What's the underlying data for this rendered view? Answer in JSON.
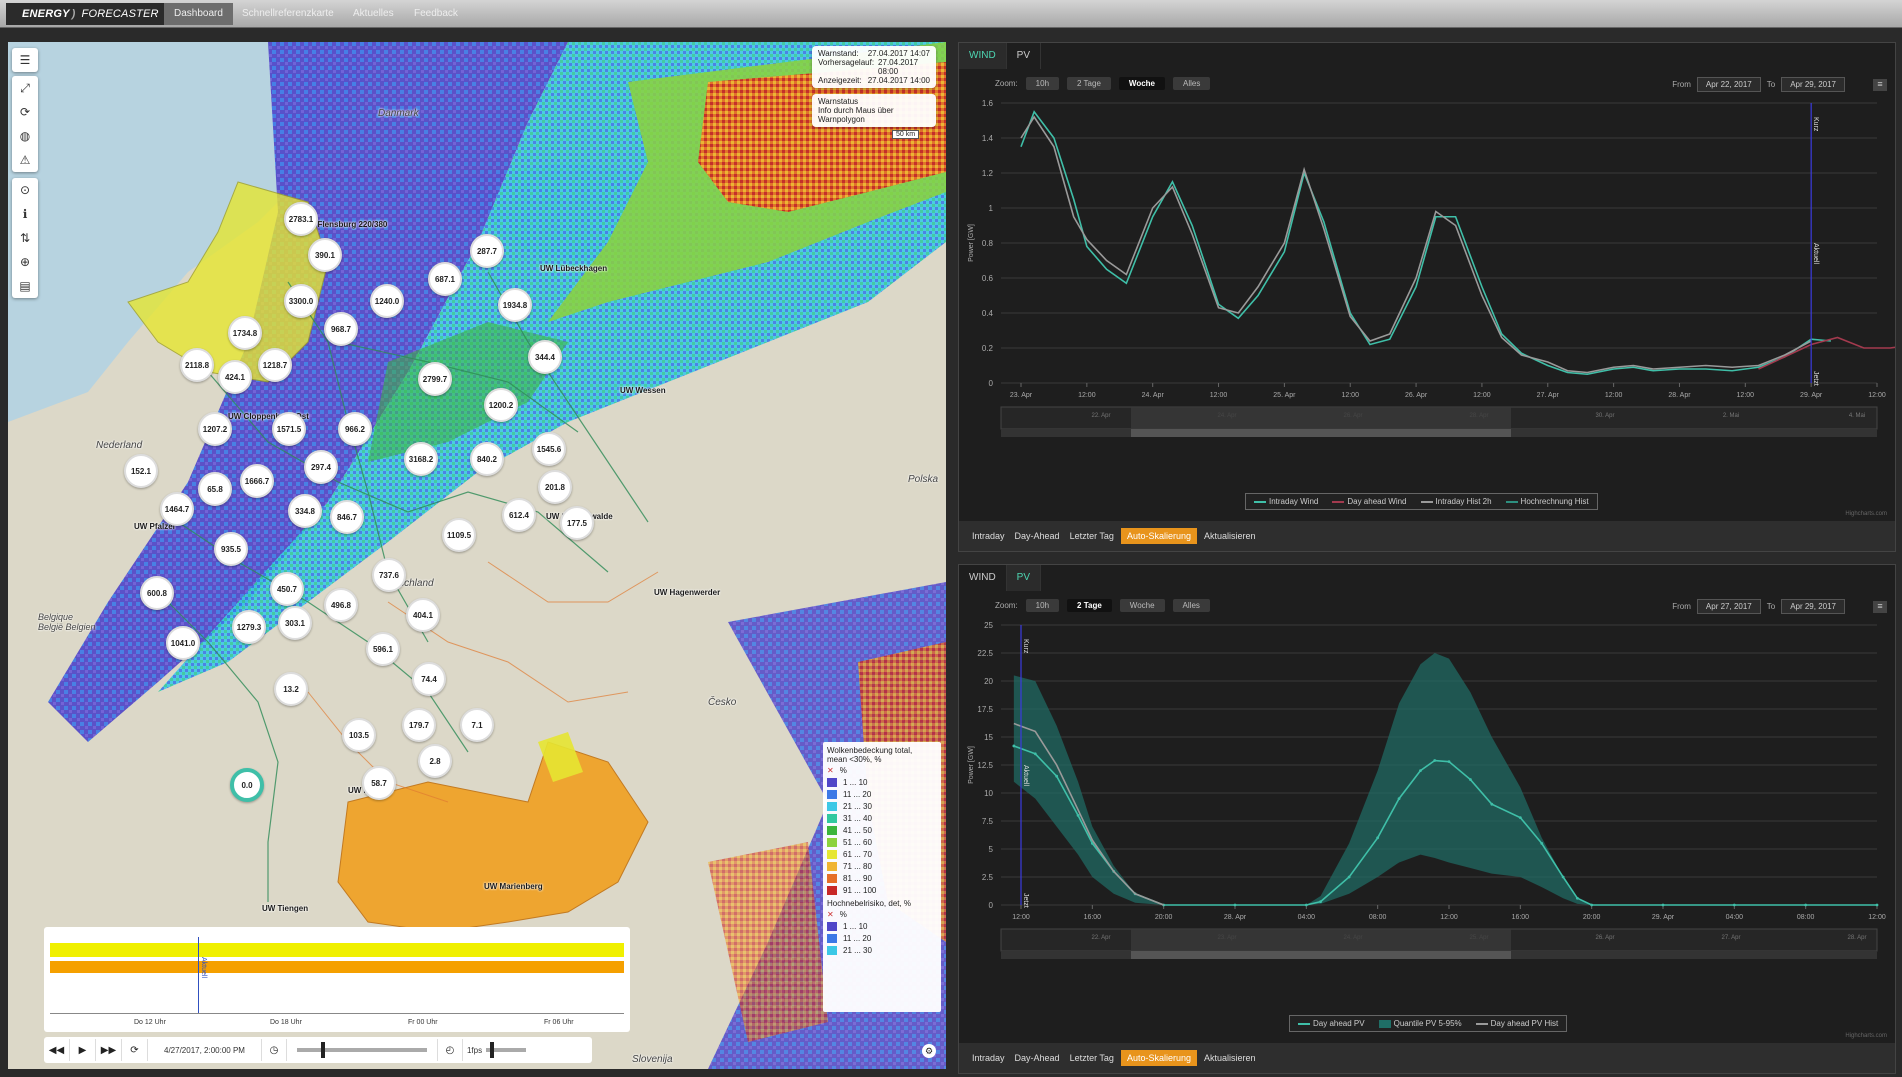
{
  "topbar": {
    "brand_energy": "ENERGY",
    "brand_forecaster": "FORECASTER",
    "nav": [
      "Dashboard",
      "Schnellreferenzkarte",
      "Aktuelles",
      "Feedback"
    ]
  },
  "map": {
    "info": {
      "warnstand_label": "Warnstand:",
      "warnstand_value": "27.04.2017 14:07",
      "vorhersage_label": "Vorhersagelauf:",
      "vorhersage_value": "27.04.2017 08:00",
      "anzeige_label": "Anzeigezeit:",
      "anzeige_value": "27.04.2017 14:00",
      "warnstatus_title": "Warnstatus",
      "warnstatus_text": "Info durch Maus über Warnpolygon",
      "scale": "50 km"
    },
    "countries": [
      "Danmark",
      "Nederland",
      "Deutschland",
      "Belgique België Belgien",
      "Polska",
      "Česko",
      "Slovenija"
    ],
    "uw_labels": [
      "UW Flensburg 220/380",
      "UW Lübeckhagen",
      "UW Cloppenburg Ost",
      "UW Wessen",
      "UW Pfalzel",
      "UW Schönewalde",
      "UW Hagenwerder",
      "UW Hoheck",
      "UW Marienberg",
      "UW Tiengen"
    ],
    "bubbles": [
      "2783.1",
      "390.1",
      "287.7",
      "687.1",
      "3300.0",
      "1240.0",
      "1934.8",
      "968.7",
      "1734.8",
      "344.4",
      "2118.8",
      "424.1",
      "1218.7",
      "2799.7",
      "1200.2",
      "1207.2",
      "1571.5",
      "966.2",
      "1545.6",
      "152.1",
      "3168.2",
      "840.2",
      "65.8",
      "1666.7",
      "297.4",
      "201.8",
      "1464.7",
      "334.8",
      "846.7",
      "612.4",
      "177.5",
      "1109.5",
      "935.5",
      "737.6",
      "600.8",
      "450.7",
      "496.8",
      "404.1",
      "1279.3",
      "303.1",
      "1041.0",
      "596.1",
      "74.4",
      "13.2",
      "7.1",
      "179.7",
      "103.5",
      "2.8",
      "58.7",
      "0.0"
    ],
    "legend": {
      "title1": "Wolkenbedeckung total,",
      "title1b": "mean <30%, %",
      "unit": "%",
      "rows1": [
        {
          "label": "1 ... 10",
          "color": "#5046c8"
        },
        {
          "label": "11 ... 20",
          "color": "#3c78e6"
        },
        {
          "label": "21 ... 30",
          "color": "#3cc8e6"
        },
        {
          "label": "31 ... 40",
          "color": "#32c8a0"
        },
        {
          "label": "41 ... 50",
          "color": "#3cb43c"
        },
        {
          "label": "51 ... 60",
          "color": "#8cd23c"
        },
        {
          "label": "61 ... 70",
          "color": "#e6e632"
        },
        {
          "label": "71 ... 80",
          "color": "#f0b432"
        },
        {
          "label": "81 ... 90",
          "color": "#e66e28"
        },
        {
          "label": "91 ... 100",
          "color": "#c82828"
        }
      ],
      "title2": "Hochnebelrisiko, det, %",
      "rows2": [
        {
          "label": "1 ... 10",
          "color": "#5046c8"
        },
        {
          "label": "11 ... 20",
          "color": "#3c78e6"
        },
        {
          "label": "21 ... 30",
          "color": "#3cc8e6"
        }
      ]
    },
    "timeline": {
      "marker": "Aktuell",
      "ticks": [
        "Do 12 Uhr",
        "Do 18 Uhr",
        "Fr 00 Uhr",
        "Fr 06 Uhr"
      ]
    },
    "playbar": {
      "datetime": "4/27/2017, 2:00:00 PM",
      "speed": "1fps"
    }
  },
  "wind_panel": {
    "tabs": [
      "WIND",
      "PV"
    ],
    "zoom_label": "Zoom:",
    "zoom_buttons": [
      "10h",
      "2 Tage",
      "Woche",
      "Alles"
    ],
    "zoom_selected": "Woche",
    "from_label": "From",
    "from_value": "Apr 22, 2017",
    "to_label": "To",
    "to_value": "Apr 29, 2017",
    "menu_icon": "hamburger-icon",
    "buttons": [
      "Intraday",
      "Day-Ahead",
      "Letzter Tag",
      "Auto-Skalierung",
      "Aktualisieren"
    ],
    "credit": "Highcharts.com",
    "navigator_ticks": [
      "22. Apr",
      "24. Apr",
      "26. Apr",
      "28. Apr",
      "30. Apr",
      "2. Mai",
      "4. Mai"
    ]
  },
  "pv_panel": {
    "tabs": [
      "WIND",
      "PV"
    ],
    "zoom_label": "Zoom:",
    "zoom_buttons": [
      "10h",
      "2 Tage",
      "Woche",
      "Alles"
    ],
    "zoom_selected": "2 Tage",
    "from_label": "From",
    "from_value": "Apr 27, 2017",
    "to_label": "To",
    "to_value": "Apr 29, 2017",
    "menu_icon": "hamburger-icon",
    "buttons": [
      "Intraday",
      "Day-Ahead",
      "Letzter Tag",
      "Auto-Skalierung",
      "Aktualisieren"
    ],
    "credit": "Highcharts.com",
    "navigator_ticks": [
      "22. Apr",
      "23. Apr",
      "24. Apr",
      "25. Apr",
      "26. Apr",
      "27. Apr",
      "28. Apr"
    ]
  },
  "chart_data": [
    {
      "type": "line",
      "ylabel": "Power [GW]",
      "ylim": [
        0,
        1.6
      ],
      "yticks": [
        "0",
        "0.2",
        "0.4",
        "0.6",
        "0.8",
        "1",
        "1.2",
        "1.4",
        "1.6"
      ],
      "xticks": [
        "23. Apr",
        "12:00",
        "24. Apr",
        "12:00",
        "25. Apr",
        "12:00",
        "26. Apr",
        "12:00",
        "27. Apr",
        "12:00",
        "28. Apr",
        "12:00",
        "29. Apr",
        "12:00"
      ],
      "markers": [
        "Kurz",
        "Aktuell",
        "Jetzt"
      ],
      "marker_t": 12.0,
      "x_unit": "ticks",
      "series": [
        {
          "name": "Intraday Wind",
          "color": "#3fbfa8",
          "x": [
            0,
            0.2,
            0.5,
            0.8,
            1.0,
            1.3,
            1.6,
            2.0,
            2.3,
            2.6,
            3.0,
            3.3,
            3.6,
            4.0,
            4.3,
            4.6,
            5.0,
            5.3,
            5.6,
            6.0,
            6.3,
            6.6,
            7.0,
            7.3,
            7.6,
            8.0,
            8.3,
            8.6,
            9.0,
            9.3,
            9.6,
            10.0,
            10.4,
            10.8,
            11.2,
            11.6,
            12.0,
            12.3
          ],
          "y": [
            1.35,
            1.55,
            1.4,
            1.05,
            0.78,
            0.65,
            0.57,
            0.95,
            1.15,
            0.9,
            0.45,
            0.37,
            0.5,
            0.75,
            1.2,
            0.92,
            0.4,
            0.22,
            0.25,
            0.55,
            0.95,
            0.95,
            0.55,
            0.28,
            0.17,
            0.1,
            0.06,
            0.05,
            0.08,
            0.09,
            0.07,
            0.08,
            0.08,
            0.07,
            0.09,
            0.15,
            0.25,
            0.24
          ]
        },
        {
          "name": "Day ahead Wind",
          "color": "#a33a4e",
          "x": [
            11.2,
            11.6,
            12.0,
            12.4,
            12.8,
            13.2,
            13.6,
            14.0,
            14.4,
            14.8,
            15.2,
            15.6,
            16.0,
            16.4,
            17.0,
            17.5,
            18.0,
            18.5,
            19.0,
            19.5,
            20.0
          ],
          "y": [
            0.08,
            0.15,
            0.22,
            0.26,
            0.2,
            0.2,
            0.22,
            0.2,
            0.2,
            0.2,
            0.22,
            0.2,
            0.21,
            0.2,
            0.23,
            0.26,
            0.28,
            0.3,
            0.34,
            0.38,
            0.36
          ]
        },
        {
          "name": "Intraday Hist 2h",
          "color": "#9a9a9a",
          "x": [
            0,
            0.2,
            0.5,
            0.8,
            1.0,
            1.3,
            1.6,
            2.0,
            2.3,
            2.6,
            3.0,
            3.3,
            3.6,
            4.0,
            4.3,
            4.6,
            5.0,
            5.3,
            5.6,
            6.0,
            6.3,
            6.6,
            7.0,
            7.3,
            7.6,
            8.0,
            8.3,
            8.6,
            9.0,
            9.3,
            9.6,
            10.0,
            10.4,
            10.8,
            11.2,
            11.6,
            12.0
          ],
          "y": [
            1.4,
            1.52,
            1.35,
            0.95,
            0.82,
            0.7,
            0.62,
            1.0,
            1.12,
            0.85,
            0.43,
            0.4,
            0.55,
            0.8,
            1.22,
            0.88,
            0.38,
            0.24,
            0.28,
            0.6,
            0.98,
            0.9,
            0.5,
            0.26,
            0.16,
            0.12,
            0.07,
            0.06,
            0.09,
            0.1,
            0.08,
            0.09,
            0.1,
            0.09,
            0.1,
            0.16,
            0.24
          ]
        },
        {
          "name": "Hochrechnung Hist",
          "color": "#2d8f7f",
          "x": [],
          "y": []
        }
      ]
    },
    {
      "type": "area",
      "ylabel": "Power [GW]",
      "ylim": [
        0,
        25
      ],
      "yticks": [
        "0",
        "2.5",
        "5",
        "7.5",
        "10",
        "12.5",
        "15",
        "17.5",
        "20",
        "22.5",
        "25"
      ],
      "xticks": [
        "12:00",
        "16:00",
        "20:00",
        "28. Apr",
        "04:00",
        "08:00",
        "12:00",
        "16:00",
        "20:00",
        "29. Apr",
        "04:00",
        "08:00",
        "12:00"
      ],
      "markers": [
        "Kurz",
        "Aktuell",
        "Jetzt"
      ],
      "marker_t": 0.0,
      "x_unit": "ticks",
      "series": [
        {
          "name": "Day ahead PV",
          "color": "#3fbfa8",
          "x": [
            -0.1,
            0.2,
            0.5,
            0.8,
            1.0,
            1.3,
            1.6,
            2.0,
            3.0,
            4.0,
            4.2,
            4.6,
            5.0,
            5.3,
            5.6,
            5.8,
            6.0,
            6.3,
            6.6,
            7.0,
            7.3,
            7.6,
            7.8,
            8.0,
            9.0,
            10.0,
            11.0,
            12.0
          ],
          "y": [
            14.2,
            13.5,
            11.5,
            8.0,
            5.5,
            3.0,
            1.0,
            0.0,
            0.0,
            0.0,
            0.3,
            2.5,
            6.0,
            9.5,
            12.0,
            12.9,
            12.8,
            11.2,
            9.0,
            7.8,
            5.5,
            2.5,
            0.6,
            0.0,
            0.0,
            0.0,
            0.0,
            0.0
          ]
        },
        {
          "name": "Quantile PV 5-95%",
          "color": "#1f6e66",
          "x": [
            -0.1,
            0.2,
            0.5,
            0.8,
            1.0,
            1.3,
            1.6,
            2.0,
            3.0,
            4.0,
            4.2,
            4.6,
            5.0,
            5.3,
            5.6,
            5.8,
            6.0,
            6.3,
            6.6,
            7.0,
            7.3,
            7.6,
            7.8,
            8.0,
            12.0
          ],
          "y_low": [
            11.0,
            9.5,
            7.0,
            4.5,
            2.5,
            1.0,
            0.2,
            0.0,
            0.0,
            0.0,
            0.1,
            1.0,
            2.5,
            3.8,
            4.5,
            4.2,
            3.8,
            3.3,
            2.8,
            2.5,
            1.6,
            0.6,
            0.1,
            0.0,
            0.0
          ],
          "y_high": [
            20.5,
            20.0,
            16.0,
            11.0,
            7.0,
            3.5,
            1.0,
            0.0,
            0.0,
            0.0,
            0.8,
            5.5,
            12.0,
            18.0,
            21.5,
            22.5,
            22.0,
            19.0,
            15.0,
            10.5,
            6.0,
            2.5,
            0.5,
            0.0,
            0.0
          ]
        },
        {
          "name": "Day ahead PV Hist",
          "color": "#9a9a9a",
          "x": [
            -0.1,
            0.2,
            0.5,
            0.8,
            1.0,
            1.3,
            1.6,
            2.0
          ],
          "y": [
            16.2,
            15.5,
            12.5,
            8.5,
            5.8,
            3.0,
            1.0,
            0.0
          ]
        }
      ]
    }
  ]
}
